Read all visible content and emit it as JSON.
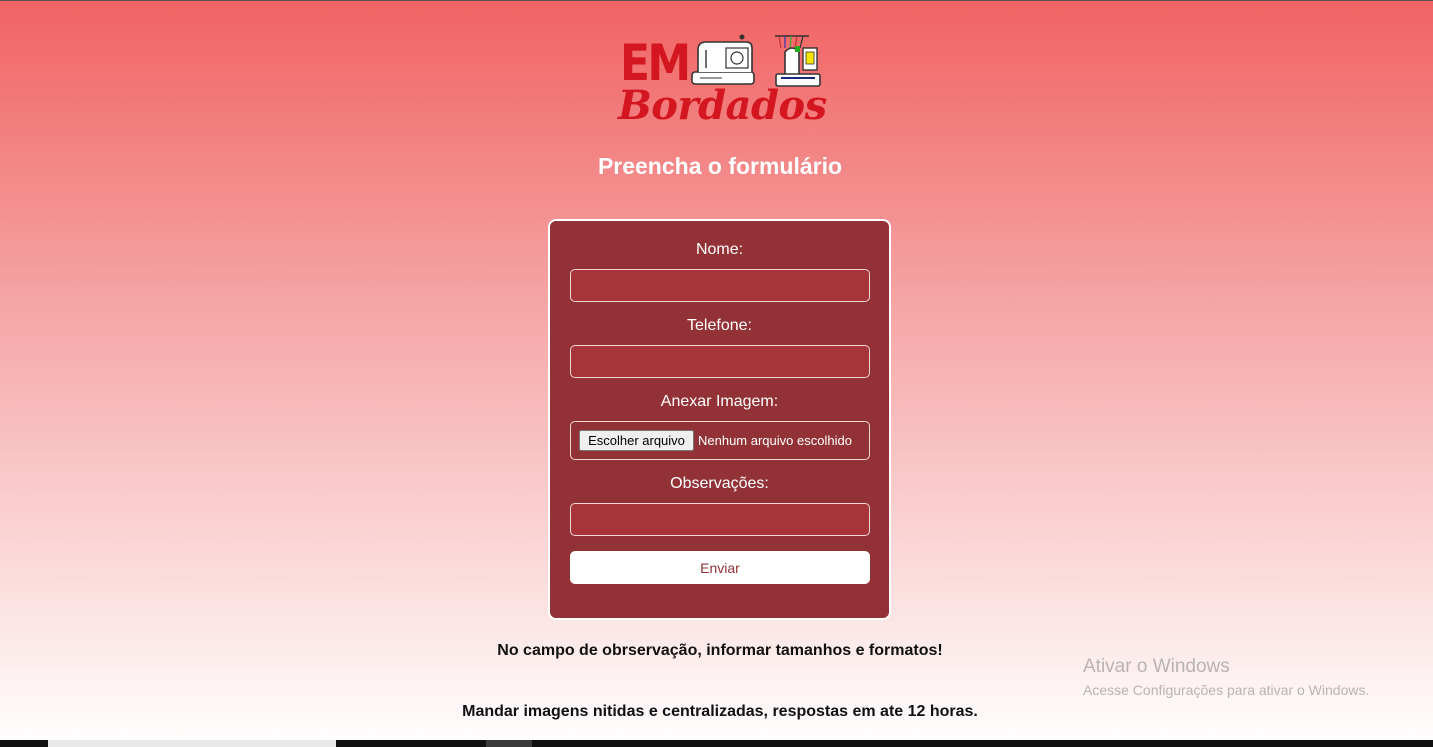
{
  "logo": {
    "em": "EM",
    "script": "Bordados"
  },
  "page": {
    "title": "Preencha o formulário"
  },
  "form": {
    "name_label": "Nome:",
    "name_value": "",
    "phone_label": "Telefone:",
    "phone_value": "",
    "image_label": "Anexar Imagem:",
    "file_button": "Escolher arquivo",
    "file_status": "Nenhum arquivo escolhido",
    "notes_label": "Observações:",
    "notes_value": "",
    "submit_label": "Enviar"
  },
  "notes": {
    "line1": "No campo de obrservação, informar tamanhos e formatos!",
    "line2": "Mandar imagens nitidas e centralizadas, respostas em ate 12 horas."
  },
  "watermark": {
    "title": "Ativar o Windows",
    "subtitle": "Acesse Configurações para ativar o Windows."
  },
  "colors": {
    "accent": "#d3161f",
    "card": "#923237",
    "field": "#a73438"
  }
}
